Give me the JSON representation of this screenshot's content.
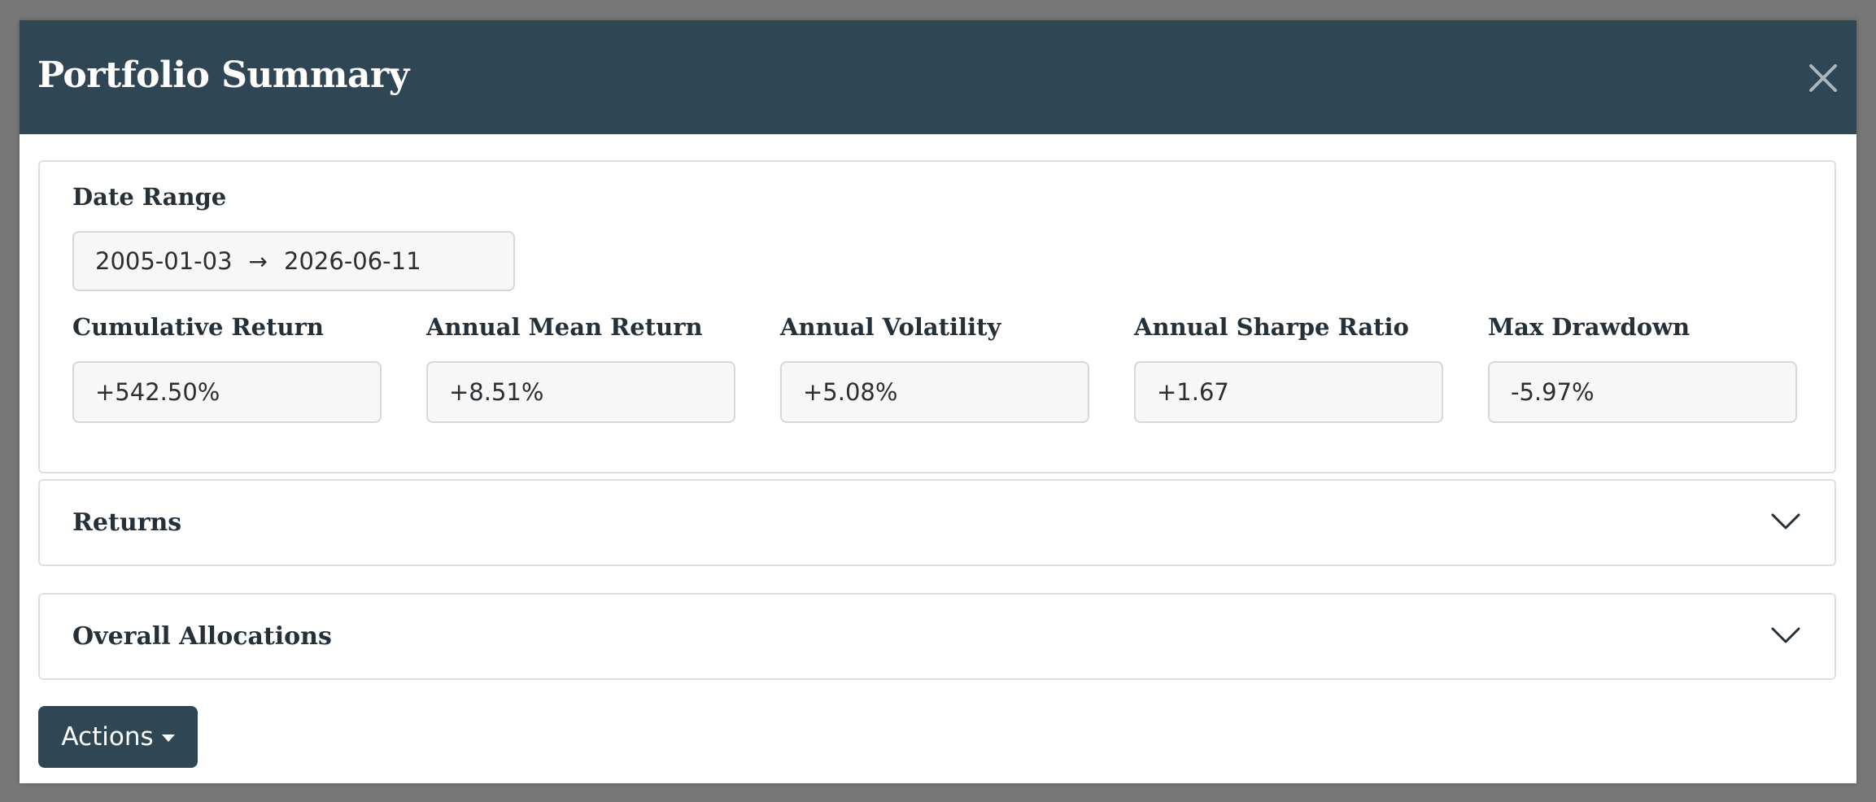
{
  "modal": {
    "title": "Portfolio Summary",
    "close_icon": "close-icon"
  },
  "date_range": {
    "label": "Date Range",
    "start": "2005-01-03",
    "arrow": "→",
    "end": "2026-06-11"
  },
  "metrics": [
    {
      "label": "Cumulative Return",
      "value": "+542.50%"
    },
    {
      "label": "Annual Mean Return",
      "value": "+8.51%"
    },
    {
      "label": "Annual Volatility",
      "value": "+5.08%"
    },
    {
      "label": "Annual Sharpe Ratio",
      "value": "+1.67"
    },
    {
      "label": "Max Drawdown",
      "value": "-5.97%"
    }
  ],
  "sections": {
    "returns": {
      "title": "Returns",
      "icon": "chevron-down-icon"
    },
    "allocations": {
      "title": "Overall Allocations",
      "icon": "chevron-down-icon"
    }
  },
  "actions": {
    "label": "Actions",
    "icon": "caret-down-icon"
  },
  "colors": {
    "header_bg": "#2f4754",
    "overlay": "#777777",
    "button_bg": "#2f4754"
  }
}
